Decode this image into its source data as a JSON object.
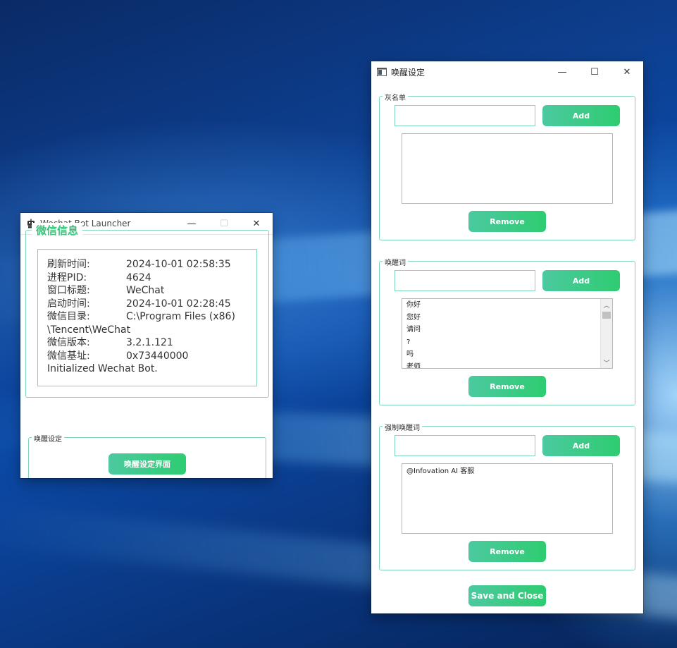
{
  "launcher": {
    "title": "Wechat Bot Launcher",
    "controls": {
      "minimize": "—",
      "maximize": "☐",
      "close": "✕"
    },
    "info_group": {
      "legend": "微信信息",
      "rows": [
        {
          "label": "刷新时间:",
          "value": "2024-10-01 02:58:35"
        },
        {
          "label": "进程PID:",
          "value": "4624"
        },
        {
          "label": "窗口标题:",
          "value": "WeChat"
        },
        {
          "label": "启动时间:",
          "value": "2024-10-01 02:28:45"
        },
        {
          "label": "微信目录:",
          "value": "C:\\Program Files (x86)"
        },
        {
          "label": "\\Tencent\\WeChat",
          "value": ""
        },
        {
          "label": "微信版本:",
          "value": "3.2.1.121"
        },
        {
          "label": "微信基址:",
          "value": "0x73440000"
        }
      ],
      "status": "Initialized Wechat Bot."
    },
    "wake_group": {
      "legend": "唤醒设定",
      "button": "唤醒设定界面"
    }
  },
  "settings": {
    "title": "唤醒设定",
    "controls": {
      "minimize": "—",
      "maximize": "☐",
      "close": "✕"
    },
    "blacklist": {
      "legend": "灰名单",
      "input_value": "",
      "add": "Add",
      "remove": "Remove",
      "items": []
    },
    "wake_words": {
      "legend": "唤醒词",
      "input_value": "",
      "add": "Add",
      "remove": "Remove",
      "items": [
        "你好",
        "您好",
        "请问",
        "?",
        "吗",
        "老师"
      ]
    },
    "force_wake_words": {
      "legend": "强制唤醒词",
      "input_value": "",
      "add": "Add",
      "remove": "Remove",
      "items": [
        "@Infovation AI 客服"
      ]
    },
    "save_close": "Save and Close"
  },
  "colors": {
    "accent": "#2ecc71",
    "accent_start": "#4cc9a0",
    "border": "#7fd6b3",
    "legend_green": "#3cc37c"
  }
}
